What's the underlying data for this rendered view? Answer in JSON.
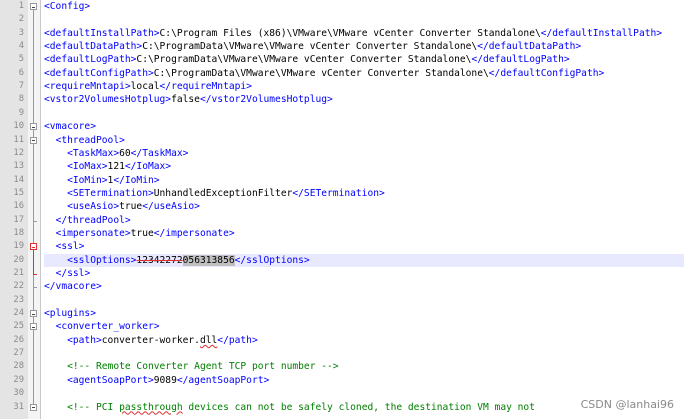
{
  "editor": {
    "lines": [
      {
        "n": "1",
        "parts": [
          {
            "k": "t",
            "s": "<Config>"
          }
        ]
      },
      {
        "n": "2",
        "parts": []
      },
      {
        "n": "3",
        "parts": [
          {
            "k": "t",
            "s": "<defaultInstallPath>"
          },
          {
            "k": "v",
            "s": "C:\\Program Files (x86)\\VMware\\VMware vCenter Converter Standalone\\"
          },
          {
            "k": "t",
            "s": "</defaultInstallPath>"
          }
        ]
      },
      {
        "n": "4",
        "parts": [
          {
            "k": "t",
            "s": "<defaultDataPath>"
          },
          {
            "k": "v",
            "s": "C:\\ProgramData\\VMware\\VMware vCenter Converter Standalone\\"
          },
          {
            "k": "t",
            "s": "</defaultDataPath>"
          }
        ]
      },
      {
        "n": "5",
        "parts": [
          {
            "k": "t",
            "s": "<defaultLogPath>"
          },
          {
            "k": "v",
            "s": "C:\\ProgramData\\VMware\\VMware vCenter Converter Standalone\\"
          },
          {
            "k": "t",
            "s": "</defaultLogPath>"
          }
        ]
      },
      {
        "n": "6",
        "parts": [
          {
            "k": "t",
            "s": "<defaultConfigPath>"
          },
          {
            "k": "v",
            "s": "C:\\ProgramData\\VMware\\VMware vCenter Converter Standalone\\"
          },
          {
            "k": "t",
            "s": "</defaultConfigPath>"
          }
        ]
      },
      {
        "n": "7",
        "parts": [
          {
            "k": "t",
            "s": "<requireMntapi>"
          },
          {
            "k": "v",
            "s": "local"
          },
          {
            "k": "t",
            "s": "</requireMntapi>"
          }
        ]
      },
      {
        "n": "8",
        "parts": [
          {
            "k": "t",
            "s": "<vstor2VolumesHotplug>"
          },
          {
            "k": "v",
            "s": "false"
          },
          {
            "k": "t",
            "s": "</vstor2VolumesHotplug>"
          }
        ]
      },
      {
        "n": "9",
        "parts": []
      },
      {
        "n": "10",
        "parts": [
          {
            "k": "t",
            "s": "<vmacore>"
          }
        ]
      },
      {
        "n": "11",
        "parts": [
          {
            "k": "v",
            "s": "  "
          },
          {
            "k": "t",
            "s": "<threadPool>"
          }
        ]
      },
      {
        "n": "12",
        "parts": [
          {
            "k": "v",
            "s": "    "
          },
          {
            "k": "t",
            "s": "<TaskMax>"
          },
          {
            "k": "v",
            "s": "60"
          },
          {
            "k": "t",
            "s": "</TaskMax>"
          }
        ]
      },
      {
        "n": "13",
        "parts": [
          {
            "k": "v",
            "s": "    "
          },
          {
            "k": "t",
            "s": "<IoMax>"
          },
          {
            "k": "v",
            "s": "121"
          },
          {
            "k": "t",
            "s": "</IoMax>"
          }
        ]
      },
      {
        "n": "14",
        "parts": [
          {
            "k": "v",
            "s": "    "
          },
          {
            "k": "t",
            "s": "<IoMin>"
          },
          {
            "k": "v",
            "s": "1"
          },
          {
            "k": "t",
            "s": "</IoMin>"
          }
        ]
      },
      {
        "n": "15",
        "parts": [
          {
            "k": "v",
            "s": "    "
          },
          {
            "k": "t",
            "s": "<SETermination>"
          },
          {
            "k": "v",
            "s": "UnhandledExceptionFilter"
          },
          {
            "k": "t",
            "s": "</SETermination>"
          }
        ]
      },
      {
        "n": "16",
        "parts": [
          {
            "k": "v",
            "s": "    "
          },
          {
            "k": "t",
            "s": "<useAsio>"
          },
          {
            "k": "v",
            "s": "true"
          },
          {
            "k": "t",
            "s": "</useAsio>"
          }
        ]
      },
      {
        "n": "17",
        "parts": [
          {
            "k": "v",
            "s": "  "
          },
          {
            "k": "t",
            "s": "</threadPool>"
          }
        ]
      },
      {
        "n": "18",
        "parts": [
          {
            "k": "v",
            "s": "  "
          },
          {
            "k": "t",
            "s": "<impersonate>"
          },
          {
            "k": "v",
            "s": "true"
          },
          {
            "k": "t",
            "s": "</impersonate>"
          }
        ]
      },
      {
        "n": "19",
        "parts": [
          {
            "k": "v",
            "s": "  "
          },
          {
            "k": "t",
            "s": "<ssl>"
          }
        ]
      },
      {
        "n": "20",
        "parts": [
          {
            "k": "v",
            "s": "    "
          },
          {
            "k": "t",
            "s": "<sslOptions>"
          },
          {
            "k": "strike",
            "s": "12342272"
          },
          {
            "k": "sel",
            "s": "056313856"
          },
          {
            "k": "t",
            "s": "</sslOptions>"
          }
        ]
      },
      {
        "n": "21",
        "parts": [
          {
            "k": "v",
            "s": "  "
          },
          {
            "k": "t",
            "s": "</ssl>"
          }
        ]
      },
      {
        "n": "22",
        "parts": [
          {
            "k": "t",
            "s": "</vmacore>"
          }
        ]
      },
      {
        "n": "23",
        "parts": []
      },
      {
        "n": "24",
        "parts": [
          {
            "k": "t",
            "s": "<plugins>"
          }
        ]
      },
      {
        "n": "25",
        "parts": [
          {
            "k": "v",
            "s": "  "
          },
          {
            "k": "t",
            "s": "<converter_worker>"
          }
        ]
      },
      {
        "n": "26",
        "parts": [
          {
            "k": "v",
            "s": "    "
          },
          {
            "k": "t",
            "s": "<path>"
          },
          {
            "k": "v",
            "s": "converter-worker."
          },
          {
            "k": "squiggle",
            "s": "dll"
          },
          {
            "k": "t",
            "s": "</path>"
          }
        ]
      },
      {
        "n": "27",
        "parts": []
      },
      {
        "n": "28",
        "parts": [
          {
            "k": "v",
            "s": "    "
          },
          {
            "k": "c",
            "s": "<!-- Remote Converter Agent TCP port number -->"
          }
        ]
      },
      {
        "n": "29",
        "parts": [
          {
            "k": "v",
            "s": "    "
          },
          {
            "k": "t",
            "s": "<agentSoapPort>"
          },
          {
            "k": "v",
            "s": "9089"
          },
          {
            "k": "t",
            "s": "</agentSoapPort>"
          }
        ]
      },
      {
        "n": "30",
        "parts": []
      },
      {
        "n": "31",
        "parts": [
          {
            "k": "v",
            "s": "    "
          },
          {
            "k": "c",
            "s": "<!-- PCI "
          },
          {
            "k": "c squiggle",
            "s": "passthrough"
          },
          {
            "k": "c",
            "s": " devices can not be safely cloned, the destination VM may not"
          }
        ]
      }
    ],
    "highlight_line": "20"
  },
  "watermark": "CSDN @lanhai96",
  "colors": {
    "tag": "#0000ff",
    "text": "#000000",
    "comment": "#008000",
    "fold_active": "#e03030",
    "gutter": "#e4e4e4",
    "current_line": "#e8e8ff"
  }
}
